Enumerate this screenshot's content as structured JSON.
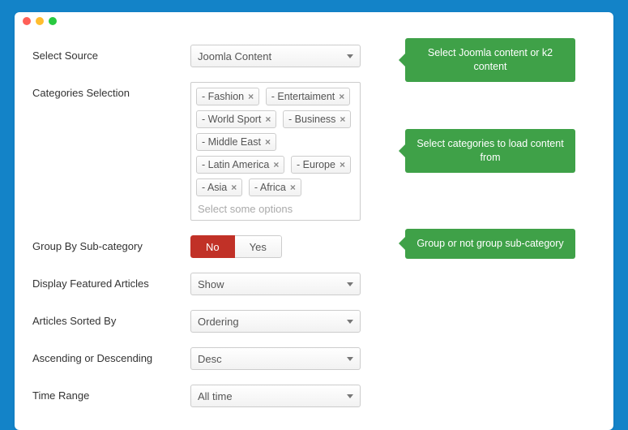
{
  "window": {
    "title": ""
  },
  "fields": {
    "source": {
      "label": "Select Source",
      "value": "Joomla Content",
      "tip": "Select Joomla content or k2 content"
    },
    "categories": {
      "label": "Categories Selection",
      "tags": [
        "- Fashion",
        "- Entertaiment",
        "- World Sport",
        "- Business",
        "- Middle East",
        "- Latin America",
        "- Europe",
        "- Asia",
        "- Africa"
      ],
      "placeholder": "Select some options",
      "tip": "Select categories to load content from"
    },
    "group": {
      "label": "Group By Sub-category",
      "no": "No",
      "yes": "Yes",
      "tip": "Group or not group sub-category"
    },
    "featured": {
      "label": "Display Featured Articles",
      "value": "Show"
    },
    "sorted": {
      "label": "Articles Sorted By",
      "value": "Ordering"
    },
    "direction": {
      "label": "Ascending or Descending",
      "value": "Desc"
    },
    "time": {
      "label": "Time Range",
      "value": "All time"
    }
  }
}
